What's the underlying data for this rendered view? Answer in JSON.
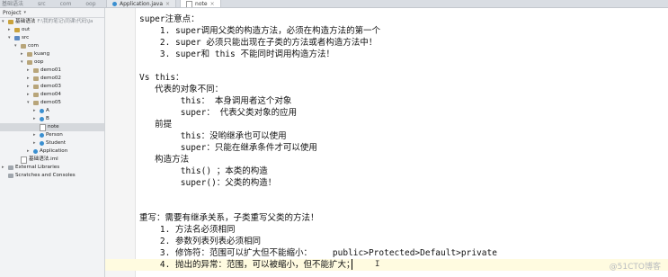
{
  "breadcrumb": [
    "基础语法",
    "src",
    "com",
    "oop",
    "demo05"
  ],
  "tabs": [
    {
      "label": "Application.java",
      "active": false
    },
    {
      "label": "note",
      "active": true
    }
  ],
  "sidebar": {
    "title": "Project",
    "items": [
      {
        "label": "基础语法",
        "extra": "F:\\我的笔记\\同课\\代码\\Ja",
        "depth": 0,
        "icon": "folder-icon",
        "kind": "folder",
        "arrow": "▾"
      },
      {
        "label": "out",
        "extra": "",
        "depth": 1,
        "icon": "folder-icon",
        "kind": "folder",
        "arrow": "▸"
      },
      {
        "label": "src",
        "extra": "",
        "depth": 1,
        "icon": "source-folder-icon",
        "kind": "src",
        "arrow": "▾"
      },
      {
        "label": "com",
        "extra": "",
        "depth": 2,
        "icon": "package-icon",
        "kind": "pkg",
        "arrow": "▾"
      },
      {
        "label": "kuang",
        "extra": "",
        "depth": 3,
        "icon": "package-icon",
        "kind": "pkg",
        "arrow": "▸"
      },
      {
        "label": "oop",
        "extra": "",
        "depth": 3,
        "icon": "package-icon",
        "kind": "pkg",
        "arrow": "▾"
      },
      {
        "label": "demo01",
        "extra": "",
        "depth": 4,
        "icon": "package-icon",
        "kind": "pkg",
        "arrow": "▸"
      },
      {
        "label": "demo02",
        "extra": "",
        "depth": 4,
        "icon": "package-icon",
        "kind": "pkg",
        "arrow": "▸"
      },
      {
        "label": "demo03",
        "extra": "",
        "depth": 4,
        "icon": "package-icon",
        "kind": "pkg",
        "arrow": "▸"
      },
      {
        "label": "demo04",
        "extra": "",
        "depth": 4,
        "icon": "package-icon",
        "kind": "pkg",
        "arrow": "▸"
      },
      {
        "label": "demo05",
        "extra": "",
        "depth": 4,
        "icon": "package-icon",
        "kind": "pkg",
        "arrow": "▾"
      },
      {
        "label": "A",
        "extra": "",
        "depth": 5,
        "icon": "class-icon",
        "kind": "cls",
        "arrow": "▸"
      },
      {
        "label": "B",
        "extra": "",
        "depth": 5,
        "icon": "class-icon",
        "kind": "cls",
        "arrow": "▸"
      },
      {
        "label": "note",
        "extra": "",
        "depth": 5,
        "icon": "text-file-icon",
        "kind": "note",
        "arrow": "",
        "selected": true
      },
      {
        "label": "Person",
        "extra": "",
        "depth": 5,
        "icon": "class-icon",
        "kind": "cls",
        "arrow": "▸"
      },
      {
        "label": "Student",
        "extra": "",
        "depth": 5,
        "icon": "class-icon",
        "kind": "cls",
        "arrow": "▸"
      },
      {
        "label": "Application",
        "extra": "",
        "depth": 4,
        "icon": "class-icon",
        "kind": "cls",
        "arrow": "▸"
      },
      {
        "label": "基础语法.iml",
        "extra": "",
        "depth": 2,
        "icon": "module-file-icon",
        "kind": "note",
        "arrow": ""
      },
      {
        "label": "External Libraries",
        "extra": "",
        "depth": 0,
        "icon": "library-icon",
        "kind": "lib",
        "arrow": "▸"
      },
      {
        "label": "Scratches and Consoles",
        "extra": "",
        "depth": 0,
        "icon": "scratches-icon",
        "kind": "lib",
        "arrow": ""
      }
    ]
  },
  "editor": {
    "gutter": [
      "22"
    ],
    "lines": [
      "super注意点：",
      "    1. super调用父类的构造方法，必须在构造方法的第一个",
      "    2. super 必须只能出现在子类的方法或者构造方法中！",
      "    3. super和 this 不能同时调用构造方法！",
      "",
      "Vs this：",
      "   代表的对象不同：",
      "        this： 本身调用者这个对象",
      "        super： 代表父类对象的应用",
      "   前提",
      "        this：没哟继承也可以使用",
      "        super：只能在继承条件才可以使用",
      "   构造方法",
      "        this() ；本类的构造",
      "        super()：父类的构造！",
      "",
      "",
      "重写：需要有继承关系，子类重写父类的方法！",
      "    1. 方法名必须相同",
      "    2. 参数列表列表必须相同",
      "    3. 修饰符：范围可以扩大但不能缩小：    public>Protected>Default>private",
      "    4. 抛出的异常：范围，可以被缩小，但不能扩大；"
    ],
    "ibeam_glyph": "I"
  },
  "watermark": "@51CTO博客",
  "colors": {
    "current_line": "#fffbe0",
    "selection": "#d5d8dc"
  }
}
